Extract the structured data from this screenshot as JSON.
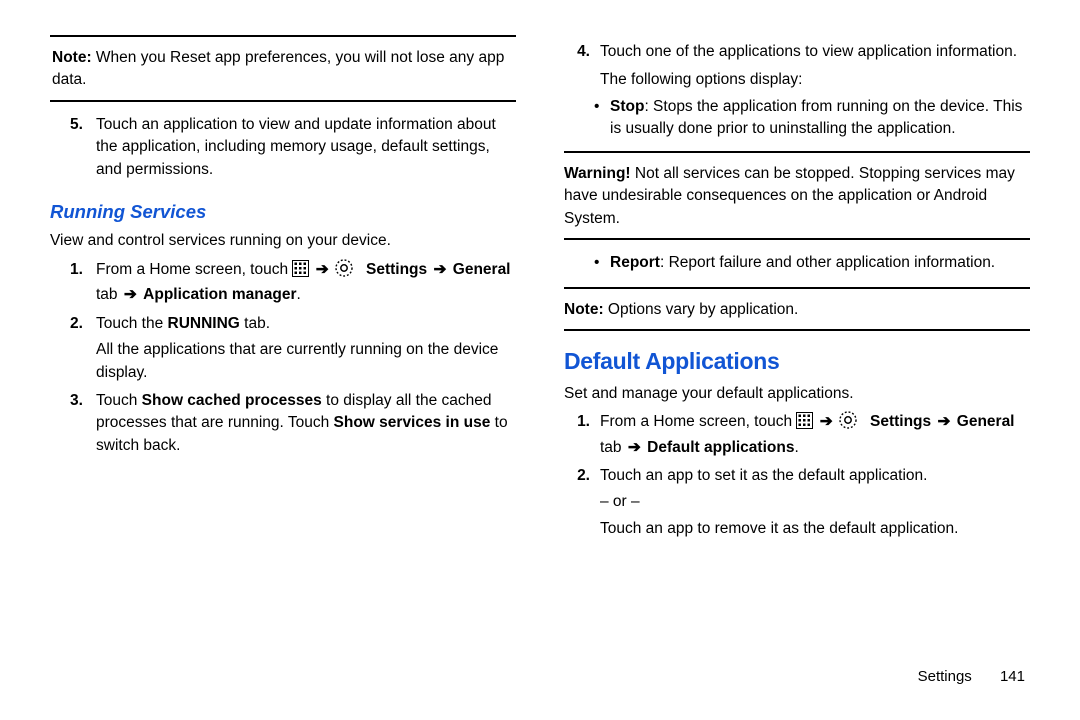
{
  "left": {
    "note1": {
      "label": "Note:",
      "text": "When you Reset app preferences, you will not lose any app data."
    },
    "step5": {
      "num": "5.",
      "text": "Touch an application to view and update information about the application, including memory usage, default settings, and permissions."
    },
    "running_heading": "Running Services",
    "running_intro": "View and control services running on your device.",
    "r_step1": {
      "num": "1.",
      "pre": "From a Home screen, touch ",
      "settings_label": "Settings",
      "general_label": "General",
      "tab_word": " tab ",
      "appmgr_label": "Application manager"
    },
    "r_step2": {
      "num": "2.",
      "part1": "Touch the ",
      "part2": "RUNNING",
      "part3": " tab.",
      "cont": "All the applications that are currently running on the device display."
    },
    "r_step3": {
      "num": "3.",
      "p1": "Touch ",
      "p2": "Show cached processes",
      "p3": " to display all the cached processes that are running. Touch ",
      "p4": "Show services in use",
      "p5": " to switch back."
    }
  },
  "right": {
    "step4": {
      "num": "4.",
      "line1": "Touch one of the applications to view application information.",
      "line2": "The following options display:"
    },
    "bullet_stop": {
      "label": "Stop",
      "text": ": Stops the application from running on the device. This is usually done prior to uninstalling the application."
    },
    "warning": {
      "label": "Warning!",
      "text": "Not all services can be stopped. Stopping services may have undesirable consequences on the application or Android System."
    },
    "bullet_report": {
      "label": "Report",
      "text": ": Report failure and other application information."
    },
    "note2": {
      "label": "Note:",
      "text": "Options vary by application."
    },
    "default_heading": "Default Applications",
    "default_intro": "Set and manage your default applications.",
    "d_step1": {
      "num": "1.",
      "pre": "From a Home screen, touch ",
      "settings_label": "Settings",
      "general_label": "General",
      "tab_word": " tab ",
      "defapp_label": "Default applications"
    },
    "d_step2": {
      "num": "2.",
      "line1": "Touch an app to set it as the default application.",
      "or": "– or –",
      "line2": "Touch an app to remove it as the default application."
    }
  },
  "arrow": "➔",
  "footer": {
    "section": "Settings",
    "page": "141"
  }
}
